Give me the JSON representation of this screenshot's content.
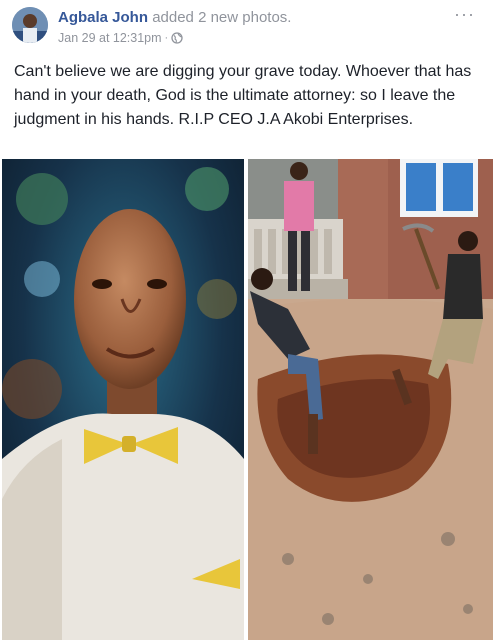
{
  "post": {
    "author_name": "Agbala John",
    "action_text": "added 2 new photos.",
    "timestamp": "Jan 29 at 12:31pm",
    "separator": "·",
    "privacy_icon": "globe-icon",
    "more_label": "···",
    "text": "Can't believe we are digging your grave today. Whoever that has hand in your death, God is the ultimate attorney: so I leave the judgment in his hands. R.I.P CEO J.A Akobi Enterprises."
  },
  "photos": [
    {
      "subject": "portrait-photo"
    },
    {
      "subject": "grave-digging-photo"
    }
  ],
  "colors": {
    "link": "#365899",
    "meta": "#90949c",
    "text": "#1d2129"
  }
}
